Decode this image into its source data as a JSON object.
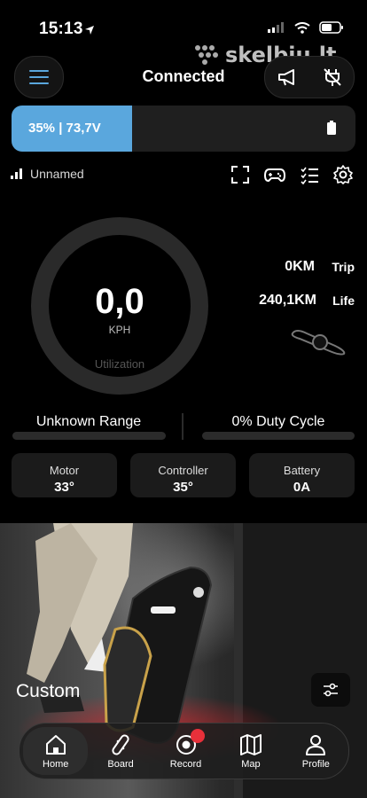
{
  "status": {
    "time": "15:13"
  },
  "watermark": "skelbiu.lt",
  "header": {
    "title": "Connected"
  },
  "battery": {
    "label": "35% | 73,7V",
    "level_percent": 35
  },
  "device": {
    "name": "Unnamed"
  },
  "speed": {
    "value": "0,0",
    "unit": "KPH",
    "gauge_label": "Utilization"
  },
  "odometer": {
    "trip_value": "0KM",
    "trip_label": "Trip",
    "life_value": "240,1KM",
    "life_label": "Life"
  },
  "range": {
    "label": "Unknown Range",
    "duty_label": "0% Duty Cycle"
  },
  "cards": [
    {
      "label": "Motor",
      "value": "33°"
    },
    {
      "label": "Controller",
      "value": "35°"
    },
    {
      "label": "Battery",
      "value": "0A"
    }
  ],
  "profile": {
    "label": "Custom"
  },
  "nav": [
    {
      "label": "Home",
      "icon": "home-icon"
    },
    {
      "label": "Board",
      "icon": "board-icon"
    },
    {
      "label": "Record",
      "icon": "record-icon"
    },
    {
      "label": "Map",
      "icon": "map-icon"
    },
    {
      "label": "Profile",
      "icon": "profile-icon"
    }
  ],
  "colors": {
    "accent": "#5aa7dd",
    "record": "#e8303a",
    "background": "#000000"
  }
}
